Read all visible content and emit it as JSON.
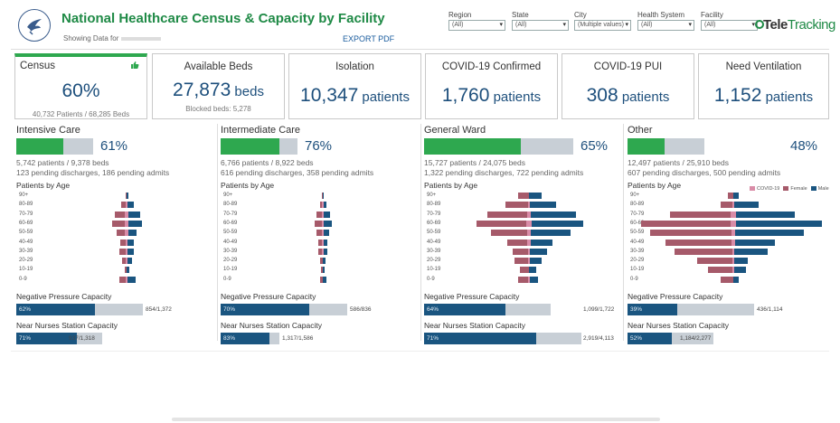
{
  "header": {
    "title": "National Healthcare Census & Capacity by Facility",
    "showing": "Showing Data for",
    "export": "EXPORT PDF",
    "brand_a": "Tele",
    "brand_b": "Tracking"
  },
  "filters": [
    {
      "label": "Region",
      "value": "(All)"
    },
    {
      "label": "State",
      "value": "(All)"
    },
    {
      "label": "City",
      "value": "(Multiple values)"
    },
    {
      "label": "Health System",
      "value": "(All)"
    },
    {
      "label": "Facility",
      "value": "(All)"
    }
  ],
  "kpis": {
    "census": {
      "title": "Census",
      "value": "60%",
      "sub": "40,732 Patients / 68,285 Beds"
    },
    "available": {
      "title": "Available Beds",
      "value": "27,873",
      "unit": " beds",
      "sub": "Blocked beds: 5,278"
    },
    "isolation": {
      "title": "Isolation",
      "value": "10,347",
      "unit": " patients"
    },
    "covid": {
      "title": "COVID-19 Confirmed",
      "value": "1,760",
      "unit": " patients"
    },
    "pui": {
      "title": "COVID-19 PUI",
      "value": "308",
      "unit": " patients"
    },
    "vent": {
      "title": "Need Ventilation",
      "value": "1,152",
      "unit": " patients"
    }
  },
  "age_groups": [
    "90+",
    "80-89",
    "70-79",
    "60-69",
    "50-59",
    "40-49",
    "30-39",
    "20-29",
    "10-19",
    "0-9"
  ],
  "legend": {
    "covid": "COVID-19",
    "female": "Female",
    "male": "Male"
  },
  "colors": {
    "female": "#a65a6a",
    "male": "#1a5580",
    "covid": "#d98ca7",
    "occupancy": "#2ea84f"
  },
  "sections": [
    {
      "title": "Intensive Care",
      "occupancy": 0.61,
      "pct": "61%",
      "patients": "5,742 patients / 9,378 beds",
      "pending": "123 pending discharges,  186 pending admits",
      "age_title": "Patients by Age",
      "pyramid": {
        "female": [
          1,
          6,
          13,
          16,
          11,
          7,
          8,
          5,
          2,
          8
        ],
        "male": [
          2,
          8,
          15,
          17,
          11,
          8,
          8,
          6,
          3,
          10
        ],
        "covid": [
          0,
          1,
          2,
          2,
          2,
          1,
          1,
          1,
          0,
          1
        ]
      },
      "neg_title": "Negative Pressure Capacity",
      "neg_fill": 0.62,
      "neg_pct": "62%",
      "neg_val": "854/1,372",
      "nurse_title": "Near Nurses Station Capacity",
      "nurse_fill": 0.71,
      "nurse_pct": "71%",
      "nurse_val": "937/1,318"
    },
    {
      "title": "Intermediate Care",
      "occupancy": 0.76,
      "pct": "76%",
      "patients": "6,766 patients / 8,922 beds",
      "pending": "616 pending discharges,  358 pending admits",
      "age_title": "Patients by Age",
      "pyramid": {
        "female": [
          1,
          3,
          7,
          9,
          7,
          5,
          5,
          3,
          2,
          3
        ],
        "male": [
          1,
          4,
          8,
          10,
          7,
          5,
          5,
          3,
          2,
          4
        ],
        "covid": [
          0,
          1,
          1,
          1,
          1,
          1,
          1,
          0,
          0,
          0
        ]
      },
      "neg_title": "Negative Pressure Capacity",
      "neg_fill": 0.7,
      "neg_pct": "70%",
      "neg_val": "586/836",
      "nurse_title": "Near Nurses Station Capacity",
      "nurse_fill": 0.83,
      "nurse_pct": "83%",
      "nurse_val": "1,317/1,586"
    },
    {
      "title": "General Ward",
      "occupancy": 0.65,
      "pct": "65%",
      "patients": "15,727 patients / 24,075 beds",
      "pending": "1,322 pending discharges,  722 pending admits",
      "age_title": "Patients by Age",
      "pyramid": {
        "female": [
          12,
          26,
          46,
          58,
          42,
          24,
          18,
          16,
          10,
          12
        ],
        "male": [
          14,
          30,
          52,
          60,
          46,
          26,
          20,
          14,
          8,
          10
        ],
        "covid": [
          0,
          1,
          2,
          3,
          2,
          2,
          1,
          1,
          0,
          1
        ]
      },
      "neg_title": "Negative Pressure Capacity",
      "neg_fill": 0.64,
      "neg_pct": "64%",
      "neg_val": "1,099/1,722",
      "nurse_title": "Near Nurses Station Capacity",
      "nurse_fill": 0.71,
      "nurse_pct": "71%",
      "nurse_val": "2,919/4,113"
    },
    {
      "title": "Other",
      "occupancy": 0.48,
      "pct": "48%",
      "patients": "12,497 patients / 25,910 beds",
      "pending": "607 pending discharges,  500 pending admits",
      "age_title": "Patients by Age",
      "pyramid": {
        "female": [
          6,
          14,
          70,
          102,
          92,
          75,
          65,
          40,
          28,
          14
        ],
        "male": [
          6,
          28,
          68,
          98,
          78,
          46,
          38,
          16,
          14,
          6
        ],
        "covid": [
          0,
          1,
          3,
          3,
          2,
          2,
          1,
          1,
          1,
          0
        ]
      },
      "neg_title": "Negative Pressure Capacity",
      "neg_fill": 0.39,
      "neg_pct": "39%",
      "neg_val": "436/1,114",
      "nurse_title": "Near Nurses Station Capacity",
      "nurse_fill": 0.52,
      "nurse_pct": "52%",
      "nurse_val": "1,184/2,277"
    }
  ]
}
